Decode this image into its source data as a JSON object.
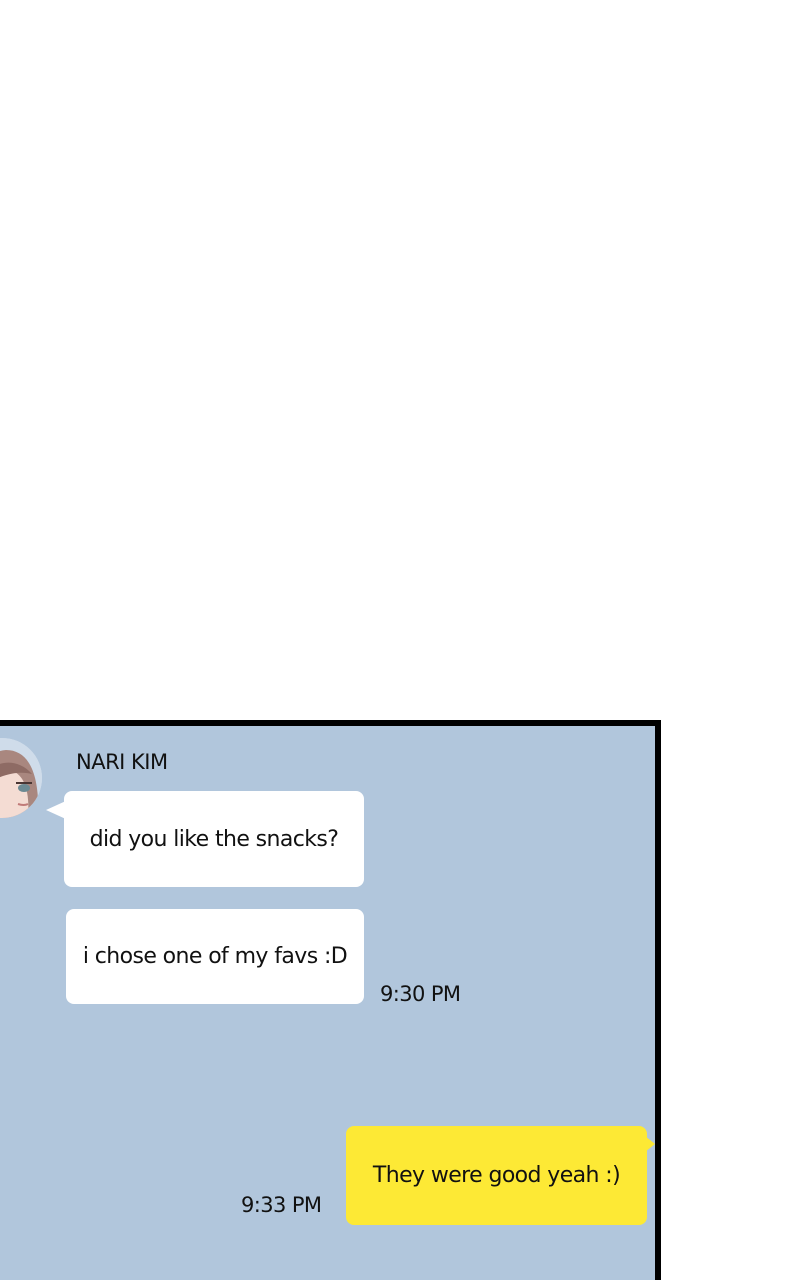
{
  "conversation": {
    "contact": {
      "name": "NARI KIM",
      "avatar_icon": "anime-girl-avatar"
    },
    "messages": [
      {
        "direction": "incoming",
        "text": "did you like the snacks?"
      },
      {
        "direction": "incoming",
        "text": "i chose one of my favs :D",
        "time": "9:30 PM"
      },
      {
        "direction": "outgoing",
        "text": "They were good yeah :)",
        "time": "9:33 PM"
      }
    ]
  },
  "colors": {
    "chat_background": "#b1c6dc",
    "incoming_bubble": "#ffffff",
    "outgoing_bubble": "#fde935",
    "panel_border": "#000000"
  }
}
